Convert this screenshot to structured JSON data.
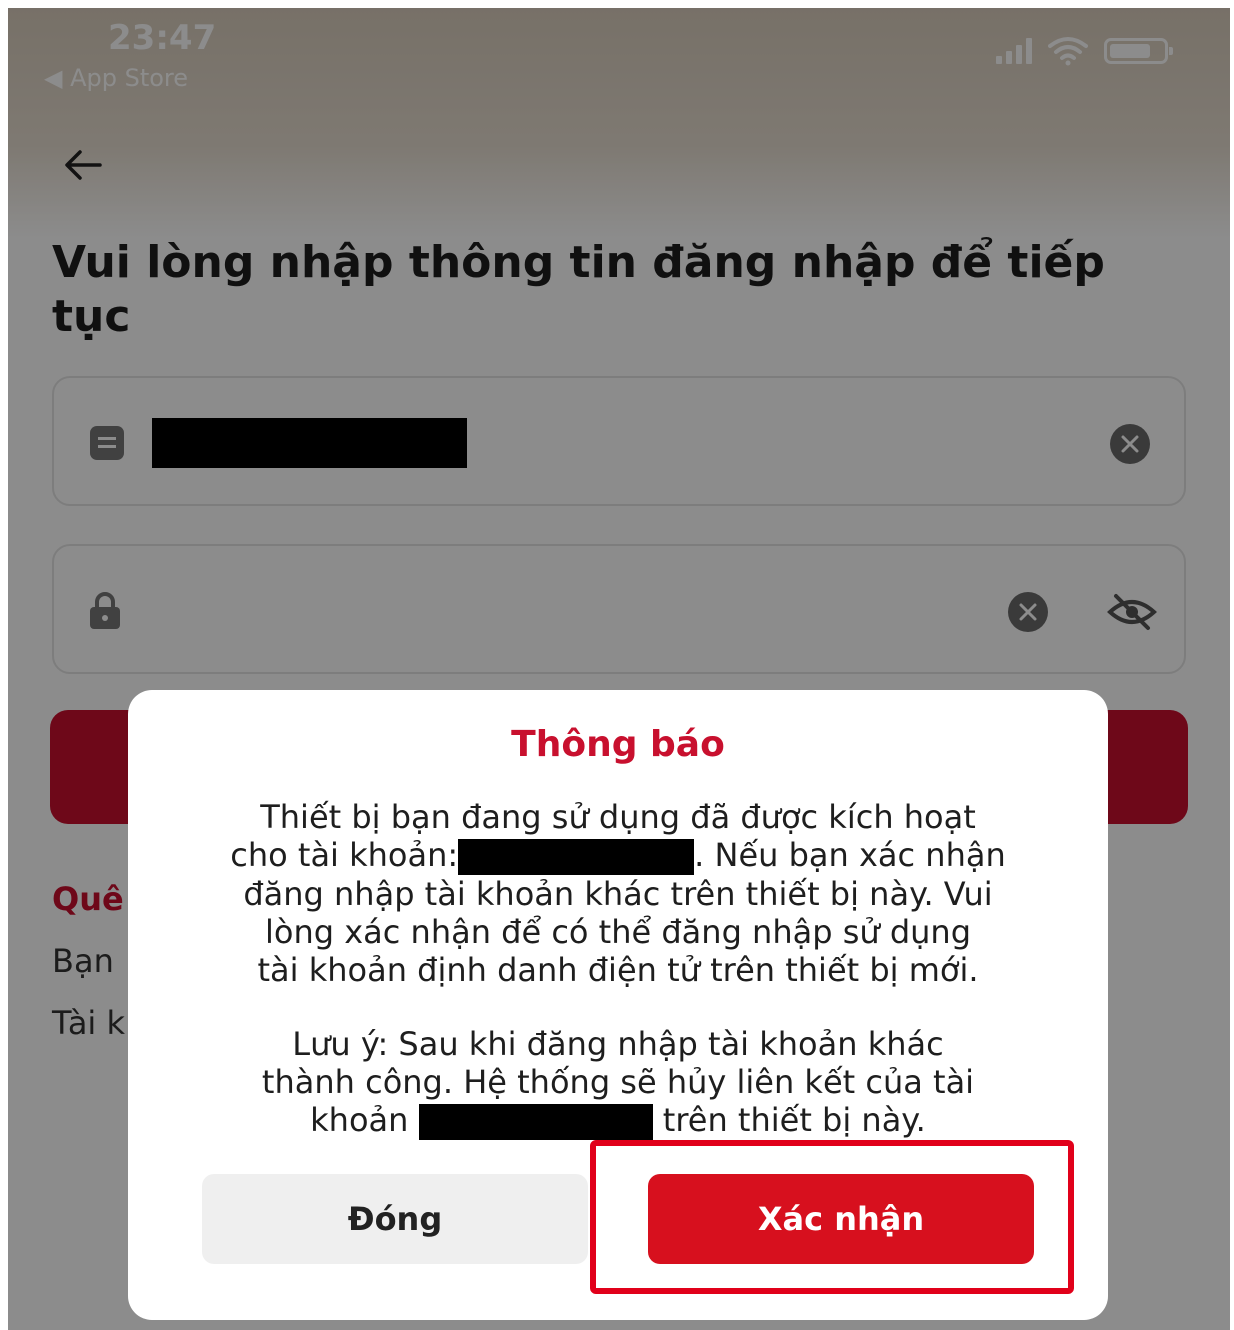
{
  "status_bar": {
    "time": "23:47",
    "back_app": "◀ App Store"
  },
  "page": {
    "title": "Vui lòng nhập thông tin đăng nhập để tiếp tục",
    "section_title_partial": "Quê",
    "text_partial_1": "Bạn",
    "text_partial_2": "Tài k"
  },
  "dialog": {
    "title": "Thông báo",
    "body_line_1": "Thiết bị bạn đang sử dụng đã được kích hoạt",
    "body_line_2_prefix": "cho tài khoản:",
    "body_line_2_suffix": ". Nếu bạn xác nhận",
    "body_line_3": "đăng nhập tài khoản khác trên thiết bị này. Vui",
    "body_line_4": "lòng xác nhận để có thể đăng nhập sử dụng",
    "body_line_5": "tài khoản định danh điện tử trên thiết bị mới.",
    "note_line_1": "Lưu ý: Sau khi đăng nhập tài khoản khác",
    "note_line_2": "thành công. Hệ thống sẽ hủy liên kết của tài",
    "note_line_3_prefix": "khoản",
    "note_line_3_suffix": "trên thiết bị này.",
    "close_label": "Đóng",
    "confirm_label": "Xác nhận"
  },
  "colors": {
    "accent": "#c8102e",
    "highlight": "#e1001a"
  }
}
